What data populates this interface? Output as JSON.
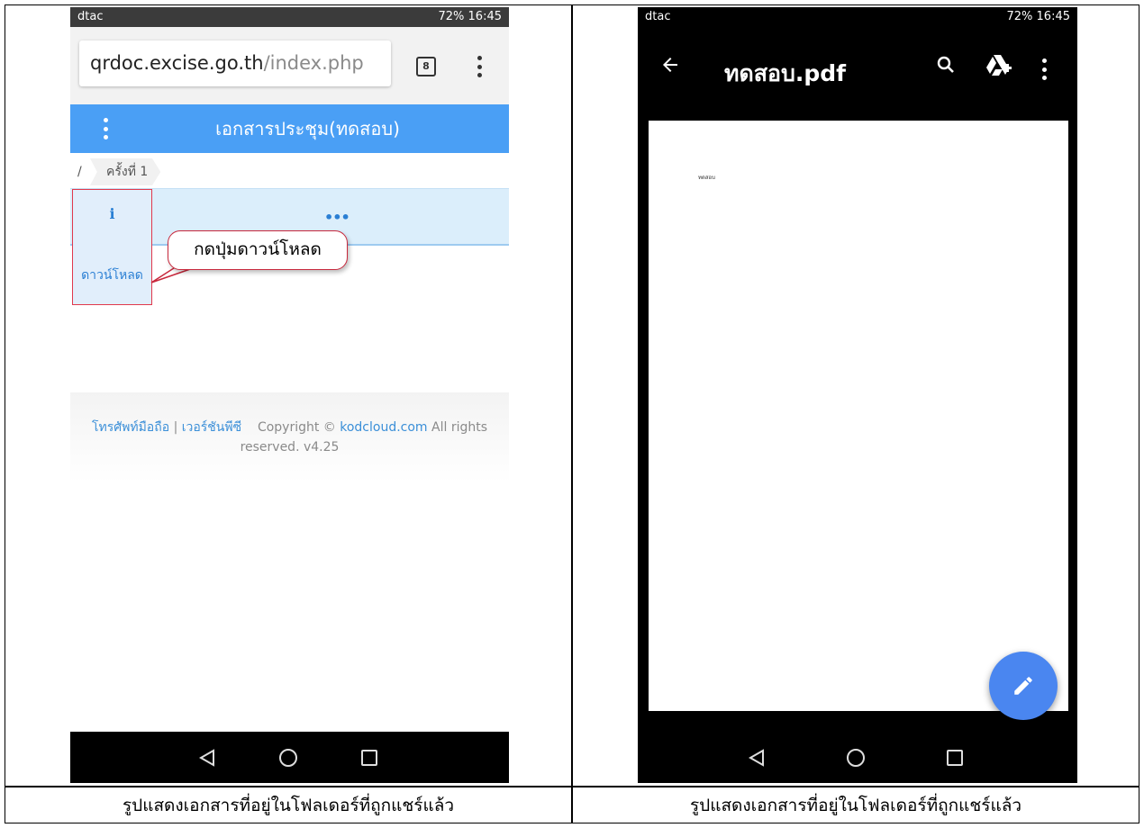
{
  "left_screen": {
    "status": {
      "carrier": "dtac",
      "system": "72%  16:45"
    },
    "address_bar": {
      "host": "qrdoc.excise.go.th",
      "path": "/index.php",
      "tab_count": "8"
    },
    "header": {
      "title": "เอกสารประชุม(ทดสอบ)"
    },
    "breadcrumb": {
      "root": "/",
      "item": "ครั้งที่ 1"
    },
    "row": {
      "more": "•••"
    },
    "download_panel": {
      "info": "i",
      "label": "ดาวน์โหลด"
    },
    "callout": {
      "text": "กดปุ่มดาวน์โหลด"
    },
    "footer": {
      "mobile_link": "โทรศัพท์มือถือ",
      "separator": "|",
      "pc_link": "เวอร์ชันพีซี",
      "copyright": "Copyright ©",
      "brand": "kodcloud.com",
      "rights": "All rights reserved. v4.25"
    }
  },
  "right_screen": {
    "status": {
      "carrier": "dtac",
      "system": "72%  16:45"
    },
    "viewer": {
      "title": "ทดสอบ.pdf",
      "page_text": "ทดสอบ"
    }
  },
  "captions": {
    "left": "รูปแสดงเอกสารที่อยู่ในโฟลเดอร์ที่ถูกแชร์แล้ว",
    "right": "รูปแสดงเอกสารที่อยู่ในโฟลเดอร์ที่ถูกแชร์แล้ว"
  },
  "colors": {
    "header_blue": "#4a9ff5",
    "highlight_red": "#e0394d",
    "fab_blue": "#4a86f0"
  },
  "icons": [
    "back-arrow-icon",
    "search-icon",
    "drive-add-icon",
    "more-vert-icon",
    "edit-pencil-icon",
    "nav-back-icon",
    "nav-home-icon",
    "nav-recents-icon"
  ]
}
